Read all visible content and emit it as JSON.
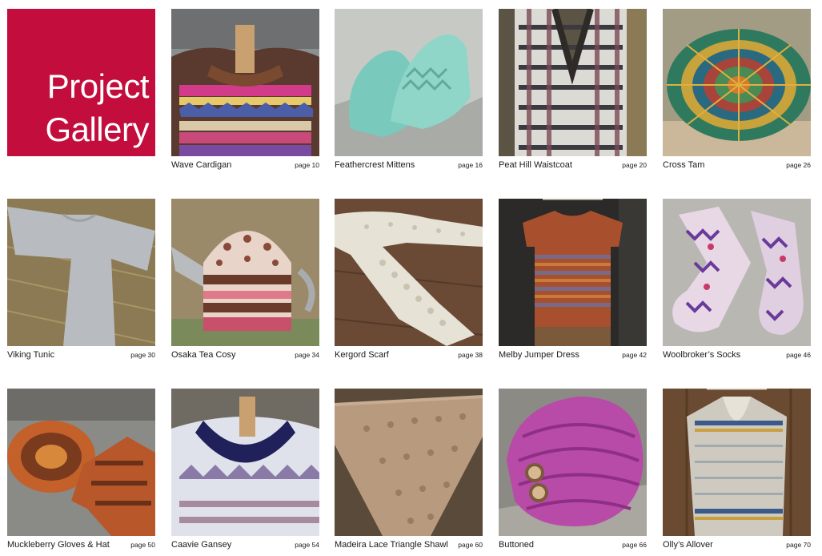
{
  "gallery": {
    "title_line1": "Project",
    "title_line2": "Gallery",
    "title_bg": "#c20d3d",
    "items": [
      {
        "name": "Wave Cardigan",
        "page": "page 10"
      },
      {
        "name": "Feathercrest Mittens",
        "page": "page 16"
      },
      {
        "name": "Peat Hill Waistcoat",
        "page": "page 20"
      },
      {
        "name": "Cross Tam",
        "page": "page 26"
      },
      {
        "name": "Viking Tunic",
        "page": "page 30"
      },
      {
        "name": "Osaka Tea Cosy",
        "page": "page 34"
      },
      {
        "name": "Kergord Scarf",
        "page": "page 38"
      },
      {
        "name": "Melby Jumper Dress",
        "page": "page 42"
      },
      {
        "name": "Woolbroker’s Socks",
        "page": "page 46"
      },
      {
        "name": "Muckleberry Gloves & Hat",
        "page": "page 50"
      },
      {
        "name": "Caavie Gansey",
        "page": "page 54"
      },
      {
        "name": "Madeira Lace Triangle Shawl",
        "page": "page 60"
      },
      {
        "name": "Buttoned",
        "page": "page 66"
      },
      {
        "name": "Olly’s Allover",
        "page": "page 70"
      }
    ]
  }
}
